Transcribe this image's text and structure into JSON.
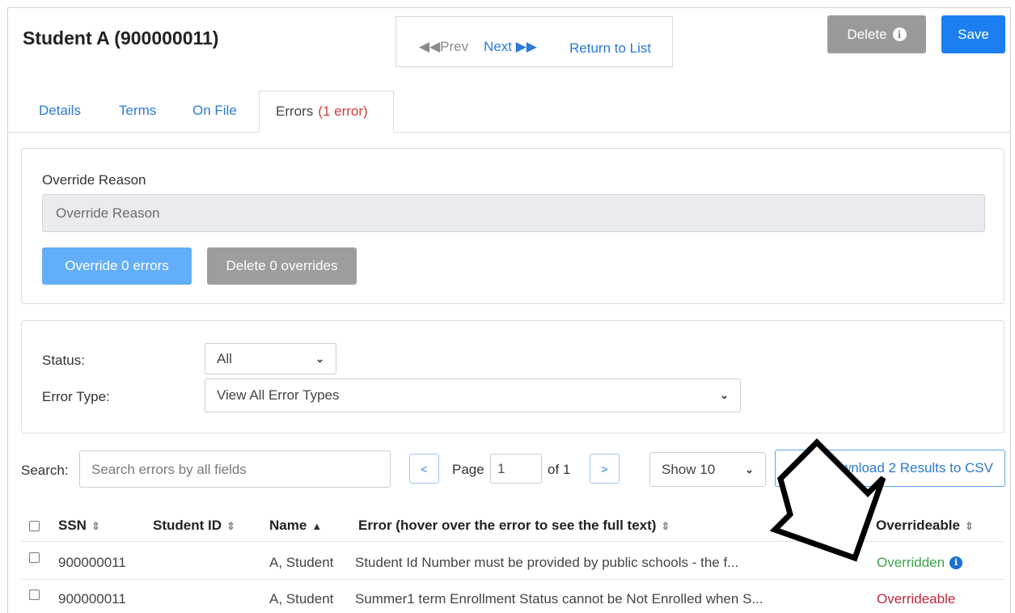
{
  "header": {
    "title": "Student A (900000011)",
    "nav": {
      "prev_label": "Prev",
      "next_label": "Next",
      "return_label": "Return to List"
    },
    "delete_label": "Delete",
    "save_label": "Save"
  },
  "tabs": [
    {
      "label": "Details"
    },
    {
      "label": "Terms"
    },
    {
      "label": "On File"
    },
    {
      "label": "Errors",
      "badge": "(1 error)"
    }
  ],
  "override": {
    "label": "Override Reason",
    "placeholder": "Override Reason",
    "override_button": "Override 0 errors",
    "delete_button": "Delete 0 overrides"
  },
  "filters": {
    "status_label": "Status:",
    "status_value": "All",
    "error_type_label": "Error Type:",
    "error_type_value": "View All Error Types"
  },
  "toolbar": {
    "search_label": "Search:",
    "search_placeholder": "Search errors by all fields",
    "page_label": "Page",
    "page_value": "1",
    "of_label": "of 1",
    "show_value": "Show 10",
    "csv_label": "Download 2 Results to CSV"
  },
  "table": {
    "columns": [
      "SSN",
      "Student ID",
      "Name",
      "Error (hover over the error to see the full text)",
      "Overrideable"
    ],
    "rows": [
      {
        "ssn": "900000011",
        "student_id": "",
        "name": "A, Student",
        "error": "Student Id Number must be provided by public schools - the f...",
        "status": "Overridden"
      },
      {
        "ssn": "900000011",
        "student_id": "",
        "name": "A, Student",
        "error": "Summer1 term Enrollment Status cannot be Not Enrolled when S...",
        "status": "Overrideable"
      }
    ]
  },
  "colors": {
    "primary": "#1b7ff2",
    "link": "#2a7ad6",
    "error": "#d23c3c",
    "overridden": "#3aa34a",
    "overrideable": "#c0283a"
  }
}
